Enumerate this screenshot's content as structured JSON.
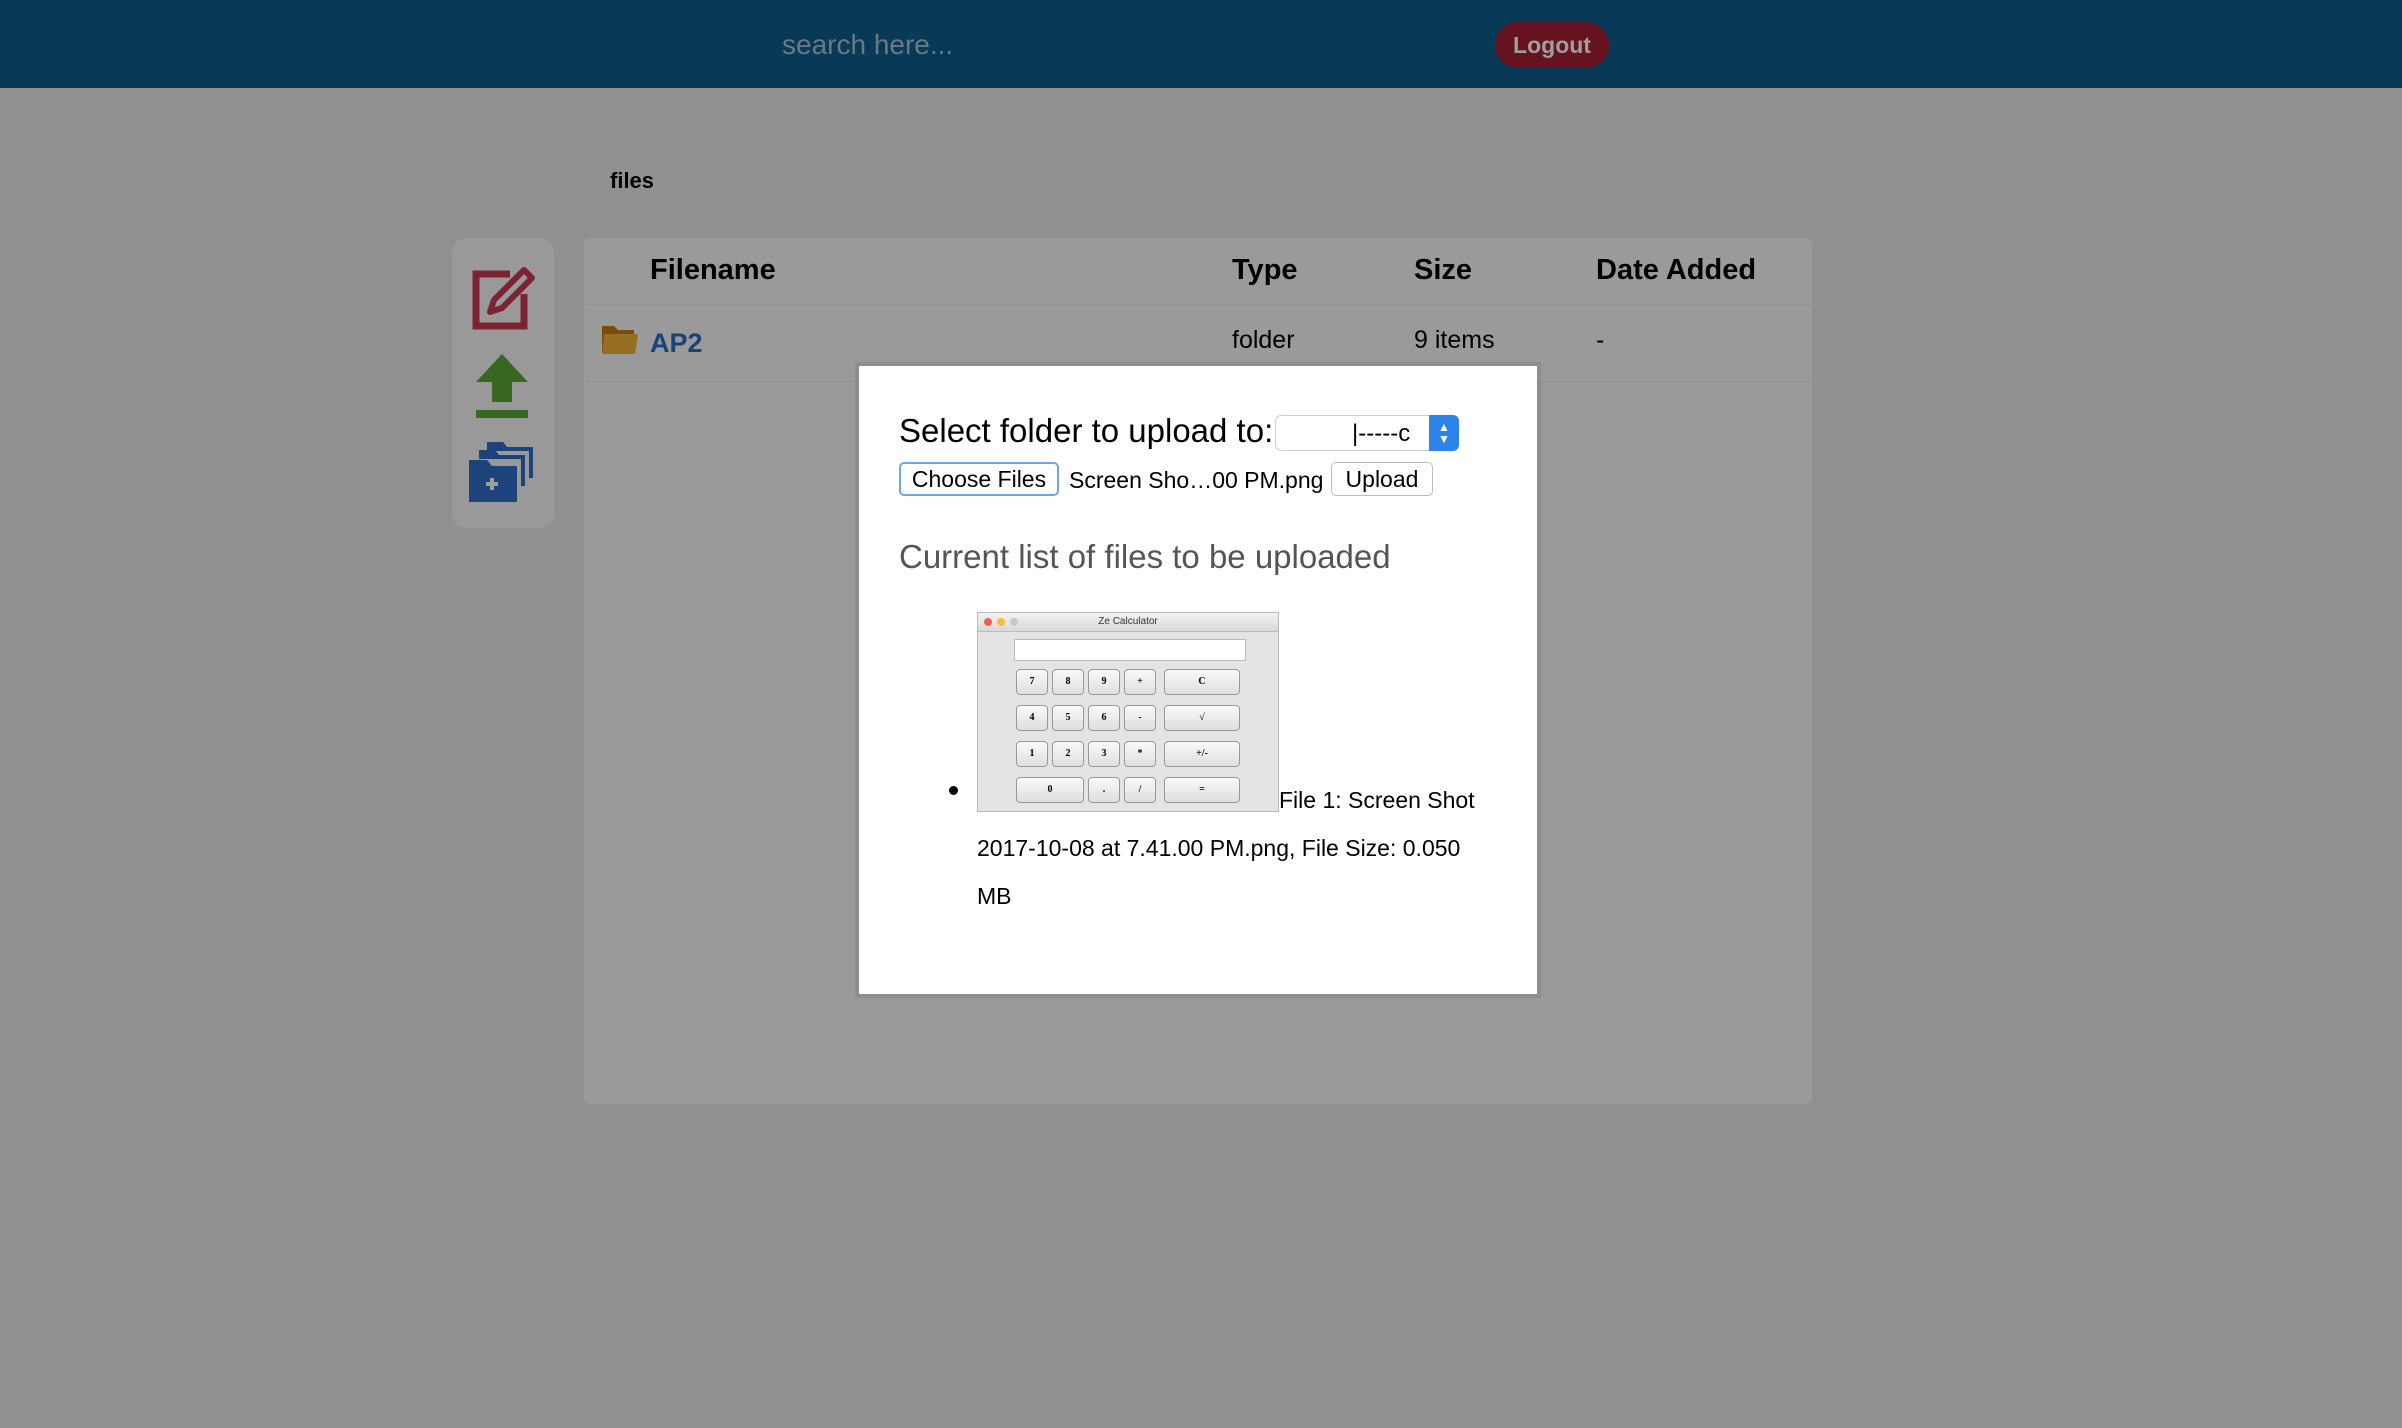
{
  "header": {
    "search_placeholder": "search here...",
    "logout_label": "Logout"
  },
  "breadcrumb": "files",
  "table": {
    "columns": [
      "Filename",
      "Type",
      "Size",
      "Date Added"
    ],
    "rows": [
      {
        "name": "AP2",
        "type": "folder",
        "size": "9 items",
        "date": "-"
      }
    ]
  },
  "modal": {
    "title": "Select folder to upload to:",
    "folder_select_value": "|-----c",
    "choose_files_label": "Choose Files",
    "chosen_file": "Screen Sho…00 PM.png",
    "upload_label": "Upload",
    "list_heading": "Current list of files to be uploaded",
    "files": [
      {
        "info": "File 1: Screen Shot 2017-10-08 at 7.41.00 PM.png, File Size: 0.050 MB"
      }
    ],
    "thumbnail": {
      "window_title": "Ze Calculator",
      "keys": [
        "7",
        "8",
        "9",
        "+",
        "C",
        "4",
        "5",
        "6",
        "-",
        "√",
        "1",
        "2",
        "3",
        "*",
        "+/-",
        "0",
        ".",
        "/",
        "="
      ]
    }
  },
  "colors": {
    "header_bg": "#0e5e8f",
    "logout_bg": "#a51d35",
    "edit_icon": "#c9374f",
    "upload_icon": "#5aa832",
    "folder_icon": "#2f6fc5",
    "link": "#2a6cc4"
  }
}
